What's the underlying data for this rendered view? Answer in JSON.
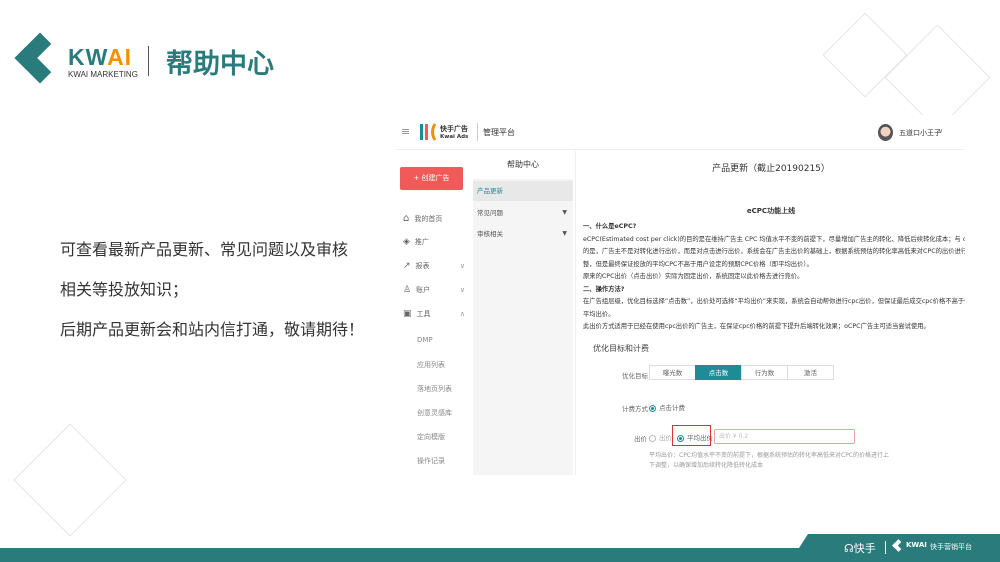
{
  "brand": {
    "logo_text_main": "KW",
    "logo_text_accent": "AI",
    "logo_sub": "KWAI MARKETING",
    "title": "帮助中心"
  },
  "description": [
    "可查看最新产品更新、常见问题以及审核",
    "相关等投放知识；",
    "后期产品更新会和站内信打通，敬请期待！"
  ],
  "colors": {
    "brand_teal": "#2a7b7b",
    "accent_orange": "#f29100",
    "create_button": "#f25a5a",
    "active_tab": "#1e8c96",
    "highlight_box": "#e03030"
  },
  "app": {
    "logo_cn": "快手广告",
    "logo_en": "Kwai Ads",
    "platform": "管理平台",
    "user": "五道口小王子",
    "create_button": "+ 创建广告",
    "nav": [
      {
        "label": "我的首页",
        "icon": "home-icon"
      },
      {
        "label": "推广",
        "icon": "layers-icon"
      },
      {
        "label": "报表",
        "icon": "chart-icon",
        "chevron": "∨"
      },
      {
        "label": "账户",
        "icon": "user-icon",
        "chevron": "∨"
      },
      {
        "label": "工具",
        "icon": "toolbox-icon",
        "chevron": "∧"
      }
    ],
    "tools_sub": [
      "DMP",
      "应用列表",
      "落地页列表",
      "创意灵感库",
      "定向模版",
      "操作记录"
    ],
    "help_menu": {
      "title": "帮助中心",
      "items": [
        {
          "label": "产品更新",
          "active": true
        },
        {
          "label": "常见问题",
          "arrow": "▼"
        },
        {
          "label": "审核相关",
          "arrow": "▼"
        }
      ]
    },
    "content": {
      "title": "产品更新（截止20190215）",
      "article_title": "eCPC功能上线",
      "lines": [
        {
          "text": "一、什么是eCPC?",
          "bold": true
        },
        {
          "text": "eCPC(Estimated cost per click)的目的是在维持广告主 CPC 均值水平不变的前提下，尽量增加广告主的转化、降低后续转化成本；与 oCPC 不同"
        },
        {
          "text": "的是，广告主不是对转化进行出价，而是对点击进行出价，系统会在广告主出价的基础上，根据系统预估的转化率高低来对CPC的出价进行上下调"
        },
        {
          "text": "整，但是最终保证投放的平均CPC不高于用户设定的预期CPC价格（即平均出价）。"
        },
        {
          "text": "原来的CPC出价（点击出价）实际为固定出价，系统固定以此价格去进行竞价。"
        },
        {
          "text": "二、操作方法?",
          "bold": true
        },
        {
          "text": "在广告组层级，优化目标选择“点击数”，出价处可选择“平均出价”来实现，系统会自动帮你进行cpc出价，但保证最后成交cpc价格不高于你设定的"
        },
        {
          "text": "平均出价。"
        },
        {
          "text": "此出价方式适用于已经在使用cpc出价的广告主，在保证cpc价格的前提下提升后端转化效果；oCPC广告主可适当尝试使用。"
        }
      ],
      "form": {
        "section": "优化目标和计费",
        "goal_label": "优化目标",
        "goals": [
          "曝光数",
          "点击数",
          "行为数",
          "激活"
        ],
        "goal_selected": "点击数",
        "billing_label": "计费方式",
        "billing_option": "点击计费",
        "bid_label": "出价",
        "bid_options": [
          "出价",
          "平均出价"
        ],
        "bid_selected": "平均出价",
        "bid_placeholder": "出价 ¥ 0.2",
        "hint": [
          "平均出价：CPC均值水平不变的前提下，根据系统预估的转化率高低来对CPC的价格进行上",
          "下调整，以确保增加后续转化降低转化成本"
        ]
      }
    }
  },
  "footer": {
    "kuaishou": "快手",
    "kwai": "KWAI",
    "platform": "快手营销平台"
  }
}
